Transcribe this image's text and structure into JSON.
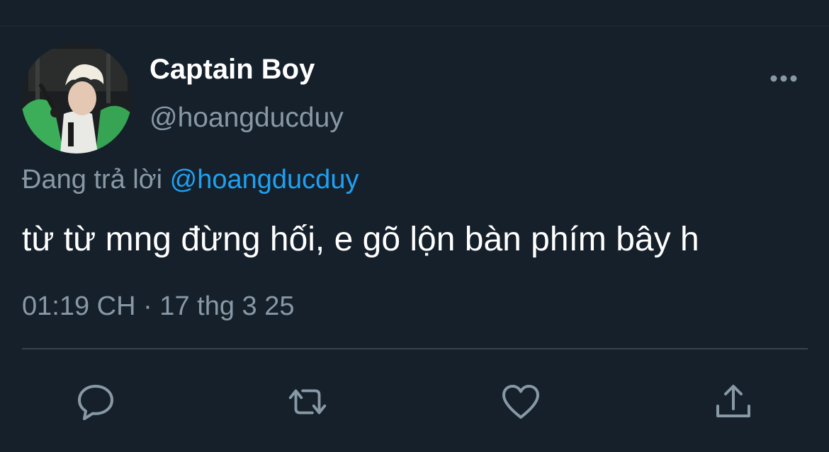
{
  "theme": {
    "background": "#15202b",
    "secondary_text": "#8899a6",
    "accent": "#1da1f2",
    "divider": "#38444d"
  },
  "author": {
    "display_name": "Captain Boy",
    "handle": "@hoangducduy",
    "avatar_icon": "profile-photo"
  },
  "reply": {
    "prefix": "Đang trả lời",
    "to_handle": "@hoangducduy"
  },
  "tweet": {
    "text": "từ từ mng đừng hối, e gõ lộn bàn phím bây h",
    "timestamp": "01:19 CH · 17 thg 3 25"
  },
  "actions": {
    "more": "more-horizontal-icon",
    "reply": "reply-bubble-icon",
    "retweet": "retweet-icon",
    "like": "heart-icon",
    "share": "share-upload-icon"
  }
}
